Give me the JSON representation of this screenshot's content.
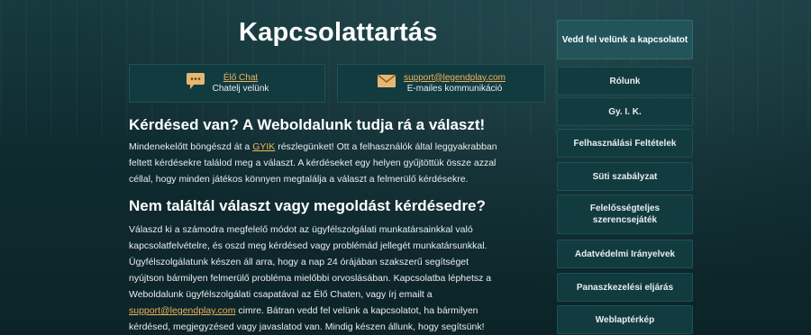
{
  "page_title": "Kapcsolattartás",
  "contact": {
    "chat": {
      "link": "Élő Chat",
      "sub": "Chatelj velünk",
      "icon": "chat-bubble-icon"
    },
    "email": {
      "link": "support@legendplay.com",
      "sub": "E-mailes kommunikáció",
      "icon": "envelope-icon"
    }
  },
  "section1": {
    "heading": "Kérdésed van? A Weboldalunk tudja rá a választ!",
    "lines": [
      [
        "Mindenekelőtt böngészd át a ",
        "GYIK",
        " részlegünket! Ott a felhasználók által leggyakrabban"
      ],
      "feltett kérdésekre találod meg a választ. A kérdéseket egy helyen gyűjtöttük össze azzal",
      "céllal, hogy minden játékos könnyen megtalálja a választ a felmerülő kérdésekre."
    ]
  },
  "section2": {
    "heading": "Nem találtál választ vagy megoldást kérdésedre?",
    "lines": [
      "Válaszd ki a számodra megfelelő módot az ügyfélszolgálati munkatársainkkal való",
      "kapcsolatfelvételre, és oszd meg kérdésed vagy problémád jellegét munkatársunkkal.",
      "Ügyfélszolgálatunk készen áll arra, hogy a nap 24 órájában szakszerű segítséget",
      "nyújtson bármilyen felmerülő probléma mielőbbi orvoslásában. Kapcsolatba léphetsz a",
      "Weboldalunk ügyfélszolgálati csapatával az Élő Chaten, vagy írj emailt a",
      [
        "support@legendplay.com",
        " cimre. Bátran vedd fel velünk a kapcsolatot, ha bármilyen"
      ],
      "kérdésed, megjegyzésed vagy javaslatod van. Mindig készen állunk, hogy segítsünk!"
    ]
  },
  "sidebar": {
    "items": [
      {
        "label": "Vedd fel velünk a kapcsolatot",
        "active": true
      },
      {
        "label": "Rólunk"
      },
      {
        "label": "Gy. I. K."
      },
      {
        "label": "Felhasználási Feltételek"
      },
      {
        "label": "Süti szabályzat"
      },
      {
        "label": "Felelősségteljes szerencsejáték"
      },
      {
        "label": "Adatvédelmi Irányelvek"
      },
      {
        "label": "Panaszkezelési eljárás"
      },
      {
        "label": "Weblaptérkép"
      }
    ]
  },
  "colors": {
    "background": "#0f2a2e",
    "panel": "#123b40",
    "accent_link": "#f0b35c",
    "active_panel": "#23545a"
  }
}
